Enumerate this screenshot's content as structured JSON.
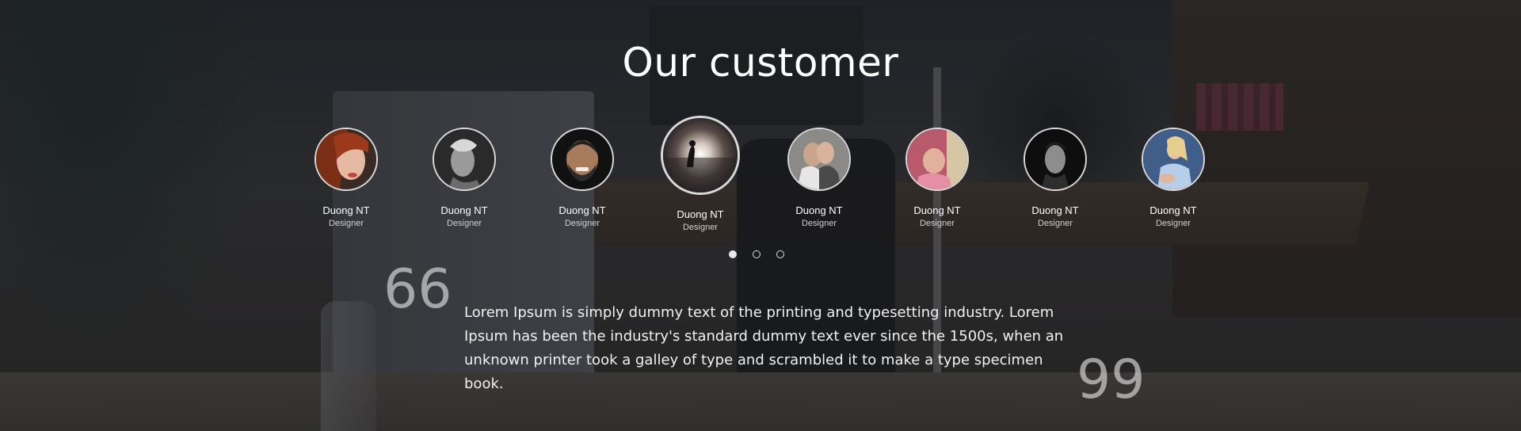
{
  "section": {
    "title": "Our customer"
  },
  "customers": [
    {
      "name": "Duong NT",
      "role": "Designer",
      "avatar": "woman-red-hair-portrait",
      "active": false
    },
    {
      "name": "Duong NT",
      "role": "Designer",
      "avatar": "monochrome-profile-portrait",
      "active": false
    },
    {
      "name": "Duong NT",
      "role": "Designer",
      "avatar": "smiling-bearded-man-portrait",
      "active": false
    },
    {
      "name": "Duong NT",
      "role": "Designer",
      "avatar": "sunset-silhouette-sea",
      "active": true
    },
    {
      "name": "Duong NT",
      "role": "Designer",
      "avatar": "couple-kissing-photo",
      "active": false
    },
    {
      "name": "Duong NT",
      "role": "Designer",
      "avatar": "woman-pink-room-photo",
      "active": false
    },
    {
      "name": "Duong NT",
      "role": "Designer",
      "avatar": "dark-portrait-woman",
      "active": false
    },
    {
      "name": "Duong NT",
      "role": "Designer",
      "avatar": "woman-sitting-blue-dress",
      "active": false
    }
  ],
  "pagination": {
    "pages": 3,
    "current": 1
  },
  "testimonial": {
    "open_quote": "66",
    "close_quote": "99",
    "text": "Lorem Ipsum is simply dummy text of the printing and typesetting industry. Lorem Ipsum has been the industry's standard dummy text ever since the 1500s, when an unknown printer took a galley of type and scrambled it to make a type specimen book."
  }
}
